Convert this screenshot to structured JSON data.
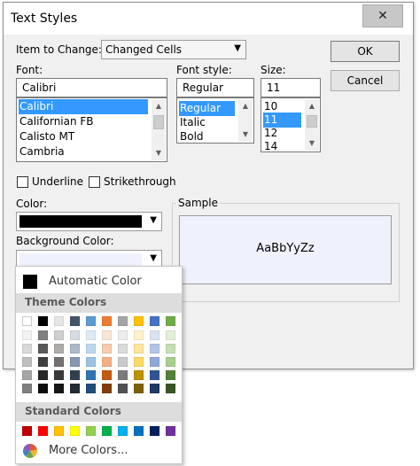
{
  "dialog": {
    "title": "Text Styles",
    "close_glyph": "✕",
    "item_to_change_label": "Item to Change:",
    "item_to_change_value": "Changed Cells",
    "ok_label": "OK",
    "cancel_label": "Cancel",
    "font_label": "Font:",
    "font_value": "Calibri",
    "fonts": [
      "Calibri",
      "Californian FB",
      "Calisto MT",
      "Cambria"
    ],
    "font_style_label": "Font style:",
    "font_style_value": "Regular",
    "font_styles": [
      "Regular",
      "Italic",
      "Bold"
    ],
    "size_label": "Size:",
    "size_value": "11",
    "sizes": [
      "10",
      "11",
      "12",
      "14"
    ],
    "underline_label": "Underline",
    "strikethrough_label": "Strikethrough",
    "color_label": "Color:",
    "background_color_label": "Background Color:",
    "sample_label": "Sample",
    "sample_text": "AaBbYyZz",
    "colors": {
      "text_color": "#000000",
      "background_color": "#eff2fc"
    }
  },
  "color_menu": {
    "automatic_label": "Automatic Color",
    "theme_colors_label": "Theme Colors",
    "standard_colors_label": "Standard Colors",
    "more_colors_label": "More Colors...",
    "theme_top": [
      "#ffffff",
      "#000000",
      "#e7e6e6",
      "#44546a",
      "#5b9bd5",
      "#ed7d31",
      "#a5a5a5",
      "#ffc000",
      "#4472c4",
      "#70ad47"
    ],
    "theme_shades": [
      [
        "#f2f2f2",
        "#7f7f7f",
        "#d0cece",
        "#d6dce4",
        "#deebf6",
        "#fbe5d5",
        "#ededed",
        "#fff2cc",
        "#dae3f3",
        "#e2efd9"
      ],
      [
        "#d8d8d8",
        "#595959",
        "#aeabab",
        "#adb9ca",
        "#bdd7ee",
        "#f7cbac",
        "#dbdbdb",
        "#fee599",
        "#b4c6e7",
        "#c5e0b3"
      ],
      [
        "#bfbfbf",
        "#3f3f3f",
        "#757070",
        "#8496b0",
        "#9cc3e5",
        "#f4b183",
        "#c9c9c9",
        "#ffd965",
        "#8eaadb",
        "#a8d08d"
      ],
      [
        "#a5a5a5",
        "#262626",
        "#3a3838",
        "#323f4f",
        "#2e75b5",
        "#c55a11",
        "#7b7b7b",
        "#bf9000",
        "#2f5496",
        "#538135"
      ],
      [
        "#7f7f7f",
        "#0c0c0c",
        "#171616",
        "#222a35",
        "#1e4e79",
        "#833c0b",
        "#525252",
        "#7f6000",
        "#1f3864",
        "#375623"
      ]
    ],
    "standard": [
      "#c00000",
      "#ff0000",
      "#ffc000",
      "#ffff00",
      "#92d050",
      "#00b050",
      "#00b0f0",
      "#0070c0",
      "#002060",
      "#7030a0"
    ]
  }
}
